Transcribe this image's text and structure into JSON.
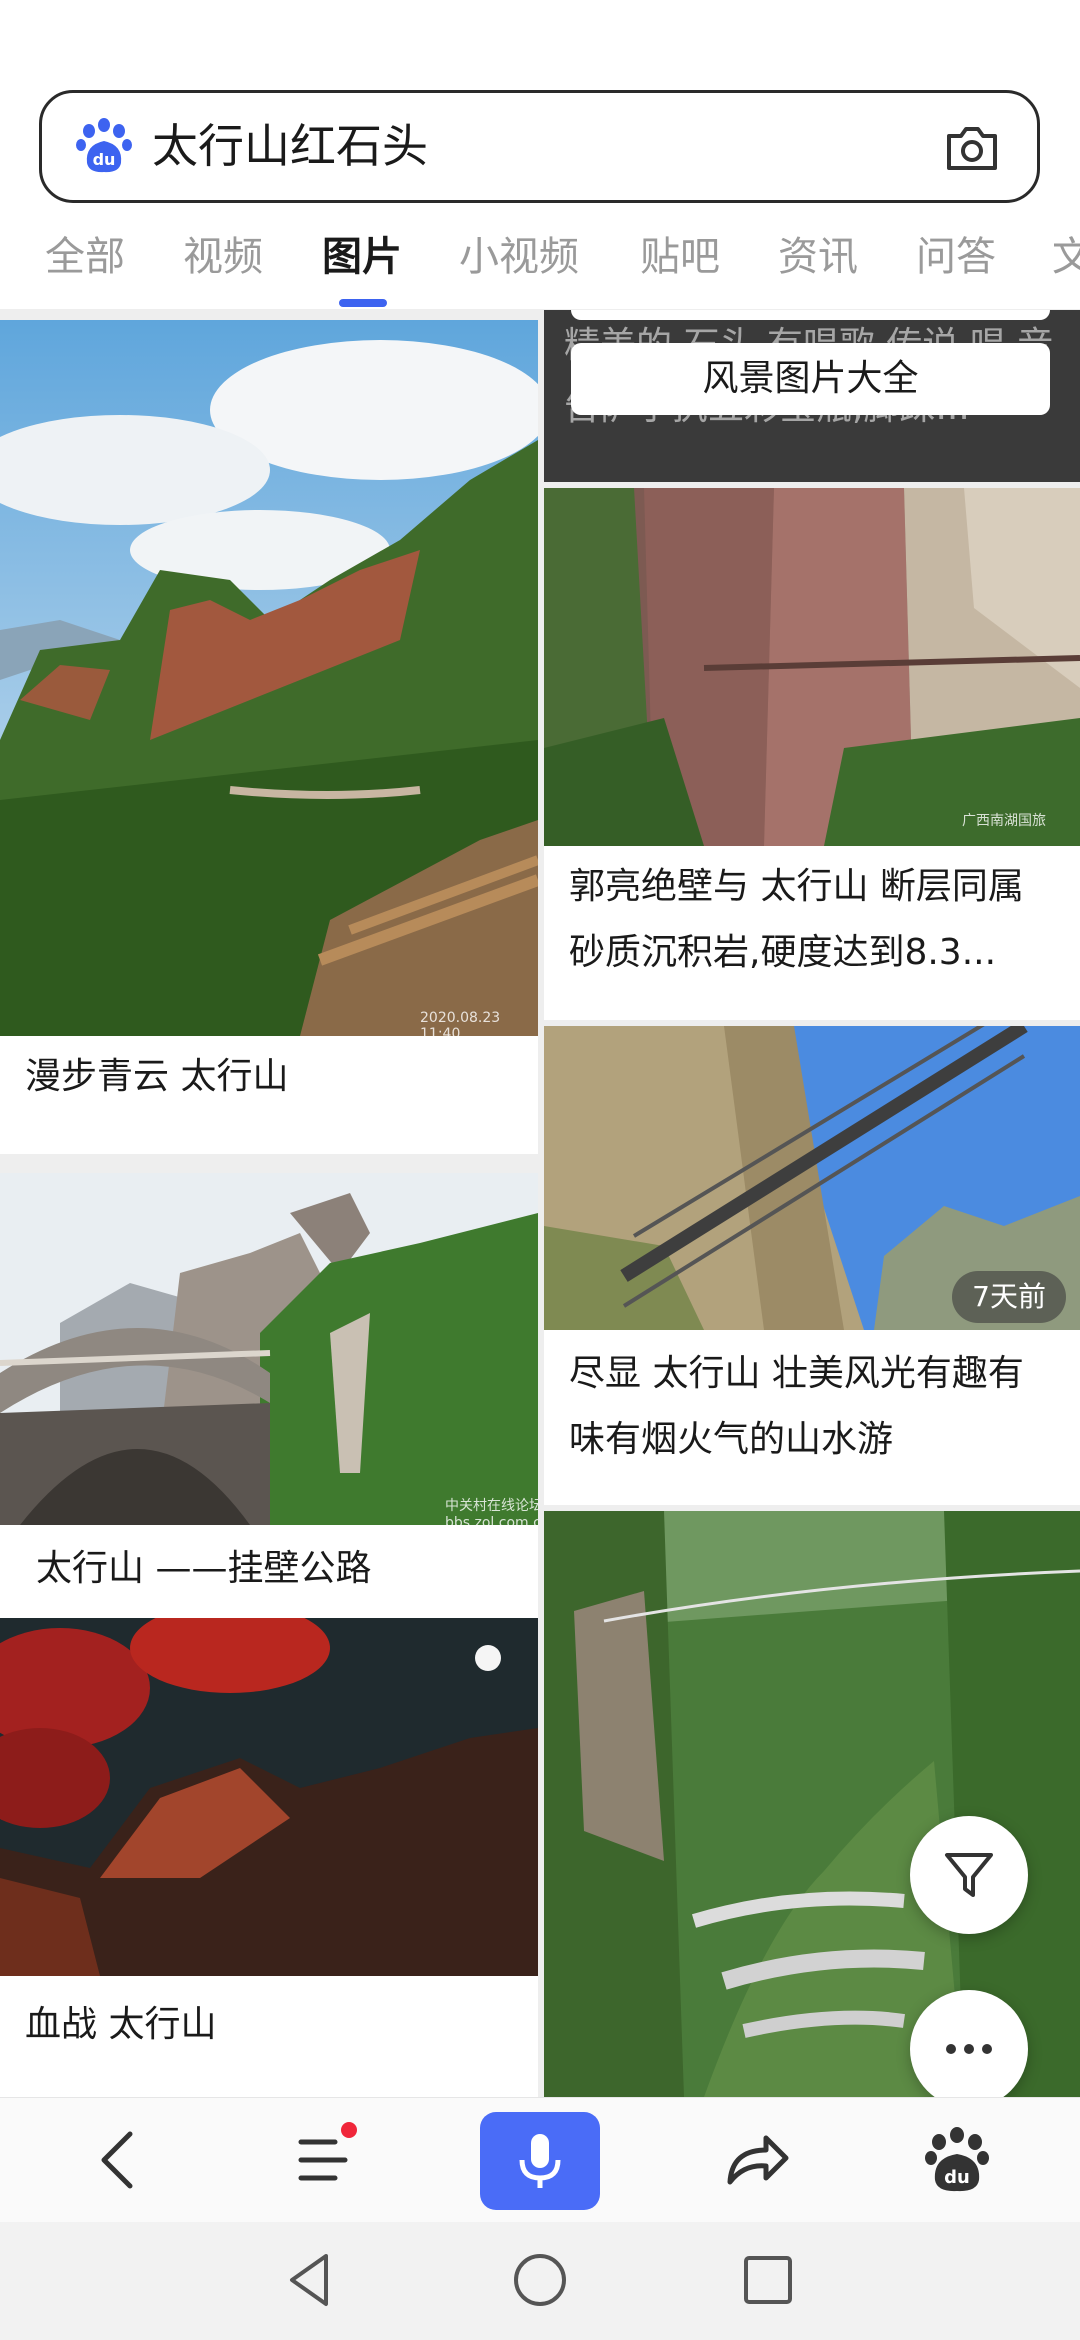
{
  "search": {
    "query": "太行山红石头",
    "logo_icon": "baidu-paw-logo",
    "camera_icon": "camera-icon"
  },
  "tabs": [
    {
      "label": "全部",
      "active": false
    },
    {
      "label": "视频",
      "active": false
    },
    {
      "label": "图片",
      "active": true
    },
    {
      "label": "小视频",
      "active": false
    },
    {
      "label": "贴吧",
      "active": false
    },
    {
      "label": "资讯",
      "active": false
    },
    {
      "label": "问答",
      "active": false
    },
    {
      "label": "文",
      "active": false
    }
  ],
  "results": {
    "left": [
      {
        "caption": "漫步青云 太行山",
        "watermark": "2020.08.23 11:40"
      },
      {
        "caption": "太行山 ——挂壁公路",
        "watermark": "中关村在线论坛 bbs.zol.com.cn"
      },
      {
        "caption": "血战 太行山"
      }
    ],
    "right": [
      {
        "banner_text": "精美的 石头 有唱歌 传说 唱 音告萨宁执五彩宝瓶,脚踩...",
        "banner_button": "风景图片大全"
      },
      {
        "caption": "郭亮绝壁与 太行山 断层同属砂质沉积岩,硬度达到8.3...",
        "watermark": "广西南湖国旅"
      },
      {
        "caption": "尽显 太行山 壮美风光有趣有味有烟火气的山水游",
        "time_badge": "7天前"
      },
      {
        "caption": ""
      }
    ]
  },
  "floating": {
    "filter_icon": "filter-funnel-icon",
    "more_icon": "more-dots-icon"
  },
  "toolbar": {
    "back_icon": "back-chevron-icon",
    "menu_icon": "menu-icon",
    "mic_icon": "microphone-icon",
    "share_icon": "share-arrow-icon",
    "home_icon": "baidu-paw-icon",
    "accent": "#4a6cf7",
    "notice_color": "#f0263a"
  },
  "system_nav": {
    "back_icon": "nav-back-triangle-icon",
    "home_icon": "nav-home-circle-icon",
    "recents_icon": "nav-recents-square-icon"
  }
}
